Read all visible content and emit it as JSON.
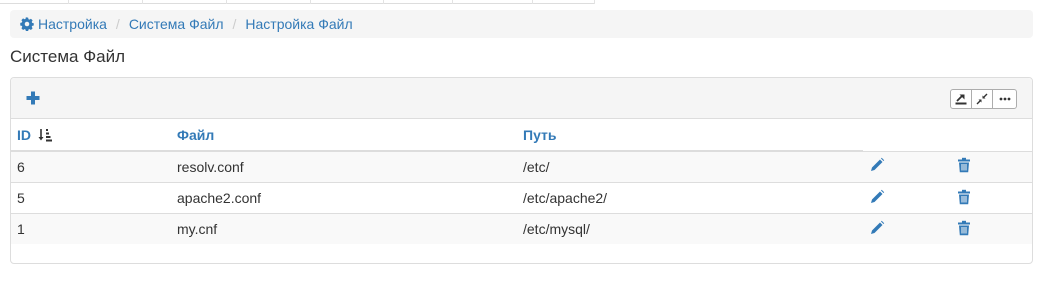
{
  "breadcrumb": {
    "home_label": "Настройка",
    "separator": "/",
    "item2_label": "Система Файл",
    "item3_label": "Настройка Файл"
  },
  "page": {
    "title": "Система Файл"
  },
  "table": {
    "headers": {
      "id": "ID",
      "file": "Файл",
      "path": "Путь"
    },
    "rows": [
      {
        "id": "6",
        "file": "resolv.conf",
        "path": "/etc/"
      },
      {
        "id": "5",
        "file": "apache2.conf",
        "path": "/etc/apache2/"
      },
      {
        "id": "1",
        "file": "my.cnf",
        "path": "/etc/mysql/"
      }
    ]
  },
  "icons": {
    "breadcrumb_home": "gear-icon",
    "add": "plus-icon",
    "toolbar": [
      "export-icon",
      "compress-icon",
      "more-icon"
    ],
    "sort": "sort-numeric-asc-icon",
    "row_actions": [
      "pencil-icon",
      "trash-icon"
    ]
  },
  "colors": {
    "accent": "#337ab7",
    "breadcrumb_bg": "#f5f5f5",
    "border": "#dddddd"
  }
}
